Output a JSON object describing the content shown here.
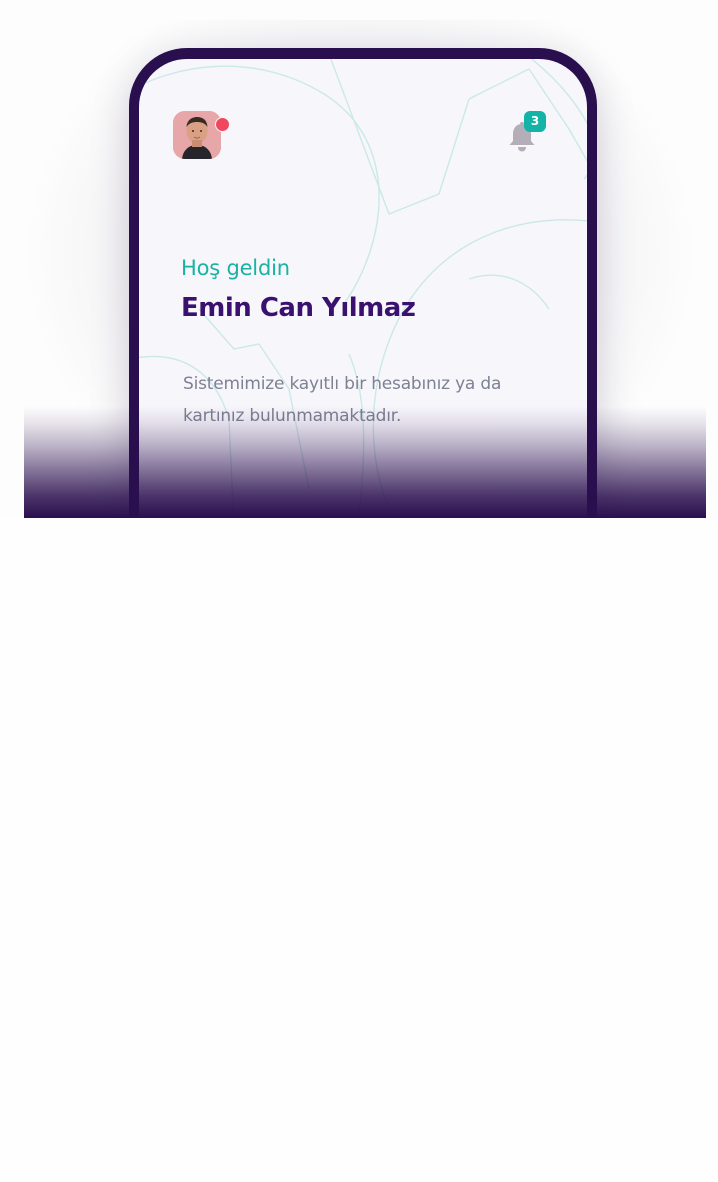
{
  "app": {
    "greeting": "Hoş geldin",
    "user_name": "Emin Can Yılmaz",
    "message": "Sistemimize kayıtlı bir hesabınız ya da kartınız bulunmamaktadır."
  },
  "header": {
    "avatar_icon": "avatar",
    "status_indicator": "online-dot",
    "notification_icon": "bell-icon",
    "notification_count": "3"
  },
  "colors": {
    "brand_purple": "#2a0f4e",
    "accent_teal": "#19b2a5",
    "name_purple": "#3b1170",
    "body_gray": "#7e8193",
    "alert_red": "#f0475e"
  }
}
